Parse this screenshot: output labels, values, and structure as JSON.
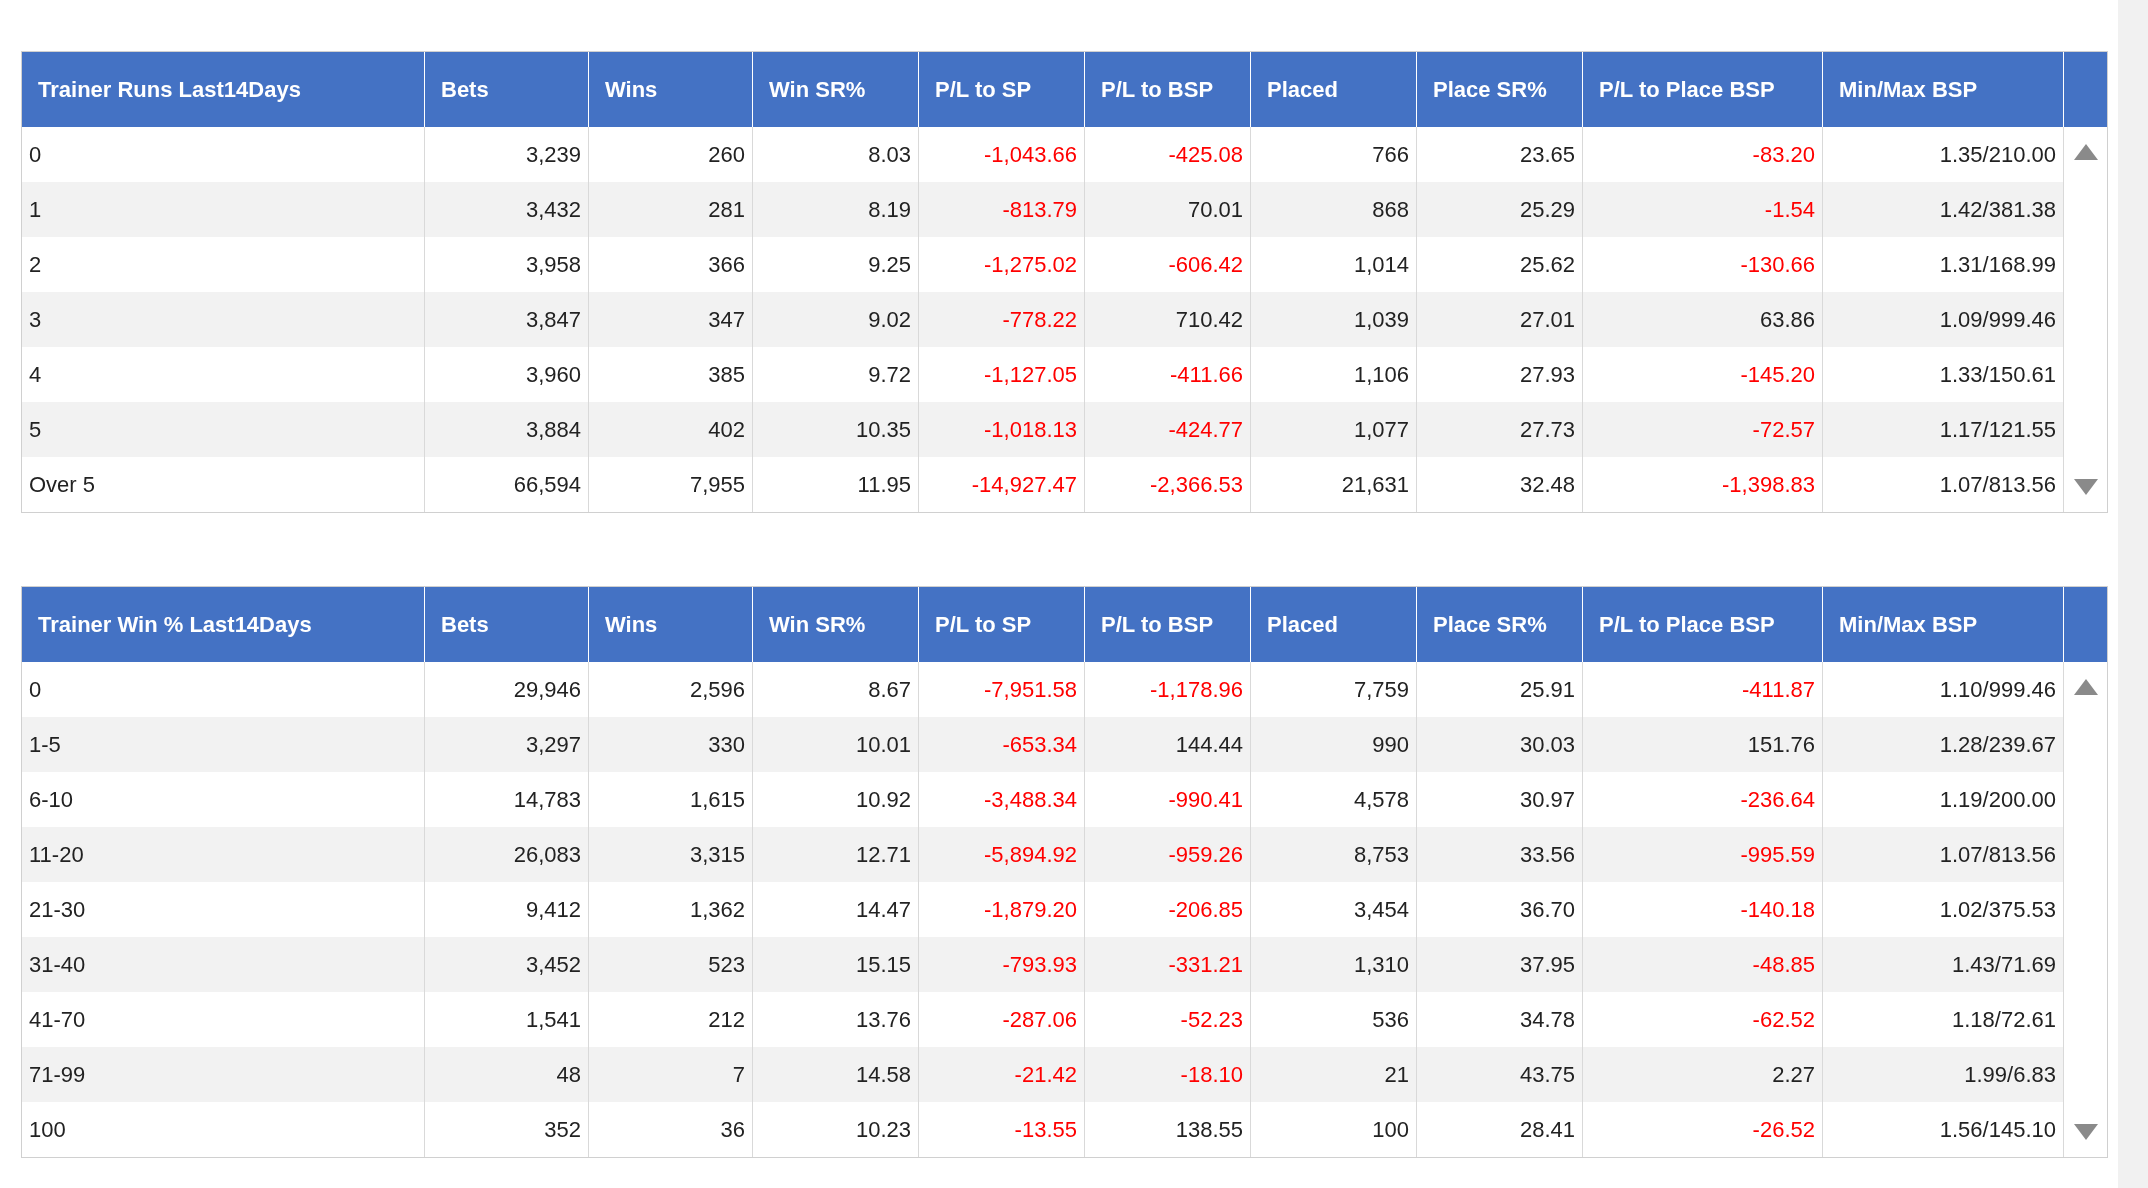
{
  "tables": [
    {
      "columns": [
        "Trainer Runs Last14Days",
        "Bets",
        "Wins",
        "Win SR%",
        "P/L to SP",
        "P/L to BSP",
        "Placed",
        "Place SR%",
        "P/L to Place BSP",
        "Min/Max BSP"
      ],
      "rows": [
        {
          "cells": [
            "0",
            "3,239",
            "260",
            "8.03",
            "-1,043.66",
            "-425.08",
            "766",
            "23.65",
            "-83.20",
            "1.35/210.00"
          ],
          "pl_negative": [
            true,
            true,
            true
          ]
        },
        {
          "cells": [
            "1",
            "3,432",
            "281",
            "8.19",
            "-813.79",
            "70.01",
            "868",
            "25.29",
            "-1.54",
            "1.42/381.38"
          ],
          "pl_negative": [
            true,
            false,
            true
          ]
        },
        {
          "cells": [
            "2",
            "3,958",
            "366",
            "9.25",
            "-1,275.02",
            "-606.42",
            "1,014",
            "25.62",
            "-130.66",
            "1.31/168.99"
          ],
          "pl_negative": [
            true,
            true,
            true
          ]
        },
        {
          "cells": [
            "3",
            "3,847",
            "347",
            "9.02",
            "-778.22",
            "710.42",
            "1,039",
            "27.01",
            "63.86",
            "1.09/999.46"
          ],
          "pl_negative": [
            true,
            false,
            false
          ]
        },
        {
          "cells": [
            "4",
            "3,960",
            "385",
            "9.72",
            "-1,127.05",
            "-411.66",
            "1,106",
            "27.93",
            "-145.20",
            "1.33/150.61"
          ],
          "pl_negative": [
            true,
            true,
            true
          ]
        },
        {
          "cells": [
            "5",
            "3,884",
            "402",
            "10.35",
            "-1,018.13",
            "-424.77",
            "1,077",
            "27.73",
            "-72.57",
            "1.17/121.55"
          ],
          "pl_negative": [
            true,
            true,
            true
          ]
        },
        {
          "cells": [
            "Over 5",
            "66,594",
            "7,955",
            "11.95",
            "-14,927.47",
            "-2,366.53",
            "21,631",
            "32.48",
            "-1,398.83",
            "1.07/813.56"
          ],
          "pl_negative": [
            true,
            true,
            true
          ]
        }
      ]
    },
    {
      "columns": [
        "Trainer Win % Last14Days",
        "Bets",
        "Wins",
        "Win SR%",
        "P/L to SP",
        "P/L to BSP",
        "Placed",
        "Place SR%",
        "P/L to Place BSP",
        "Min/Max BSP"
      ],
      "rows": [
        {
          "cells": [
            "0",
            "29,946",
            "2,596",
            "8.67",
            "-7,951.58",
            "-1,178.96",
            "7,759",
            "25.91",
            "-411.87",
            "1.10/999.46"
          ],
          "pl_negative": [
            true,
            true,
            true
          ]
        },
        {
          "cells": [
            "1-5",
            "3,297",
            "330",
            "10.01",
            "-653.34",
            "144.44",
            "990",
            "30.03",
            "151.76",
            "1.28/239.67"
          ],
          "pl_negative": [
            true,
            false,
            false
          ]
        },
        {
          "cells": [
            "6-10",
            "14,783",
            "1,615",
            "10.92",
            "-3,488.34",
            "-990.41",
            "4,578",
            "30.97",
            "-236.64",
            "1.19/200.00"
          ],
          "pl_negative": [
            true,
            true,
            true
          ]
        },
        {
          "cells": [
            "11-20",
            "26,083",
            "3,315",
            "12.71",
            "-5,894.92",
            "-959.26",
            "8,753",
            "33.56",
            "-995.59",
            "1.07/813.56"
          ],
          "pl_negative": [
            true,
            true,
            true
          ]
        },
        {
          "cells": [
            "21-30",
            "9,412",
            "1,362",
            "14.47",
            "-1,879.20",
            "-206.85",
            "3,454",
            "36.70",
            "-140.18",
            "1.02/375.53"
          ],
          "pl_negative": [
            true,
            true,
            true
          ]
        },
        {
          "cells": [
            "31-40",
            "3,452",
            "523",
            "15.15",
            "-793.93",
            "-331.21",
            "1,310",
            "37.95",
            "-48.85",
            "1.43/71.69"
          ],
          "pl_negative": [
            true,
            true,
            true
          ]
        },
        {
          "cells": [
            "41-70",
            "1,541",
            "212",
            "13.76",
            "-287.06",
            "-52.23",
            "536",
            "34.78",
            "-62.52",
            "1.18/72.61"
          ],
          "pl_negative": [
            true,
            true,
            true
          ]
        },
        {
          "cells": [
            "71-99",
            "48",
            "7",
            "14.58",
            "-21.42",
            "-18.10",
            "21",
            "43.75",
            "2.27",
            "1.99/6.83"
          ],
          "pl_negative": [
            true,
            true,
            false
          ]
        },
        {
          "cells": [
            "100",
            "352",
            "36",
            "10.23",
            "-13.55",
            "138.55",
            "100",
            "28.41",
            "-26.52",
            "1.56/145.10"
          ],
          "pl_negative": [
            true,
            false,
            true
          ]
        }
      ]
    }
  ]
}
